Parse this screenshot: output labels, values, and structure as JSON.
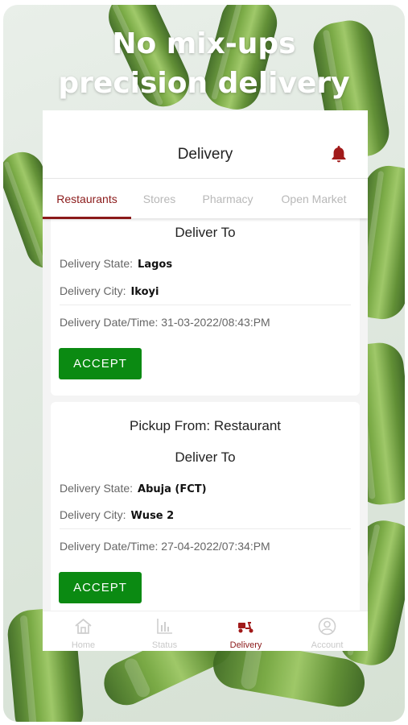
{
  "poster": {
    "headline_line1": "No mix-ups",
    "headline_line2": "precision delivery"
  },
  "appbar": {
    "title": "Delivery",
    "bell_icon": "bell-icon",
    "accent_color": "#8b1a1a"
  },
  "tabs": [
    {
      "label": "Restaurants",
      "active": true
    },
    {
      "label": "Stores",
      "active": false
    },
    {
      "label": "Pharmacy",
      "active": false
    },
    {
      "label": "Open Market",
      "active": false
    }
  ],
  "orders": [
    {
      "deliver_to_label": "Deliver To",
      "state_label": "Delivery State:",
      "state_value": "Lagos",
      "city_label": "Delivery City:",
      "city_value": "Ikoyi",
      "datetime_text": "Delivery Date/Time: 31-03-2022/08:43:PM",
      "accept_label": "ACCEPT"
    },
    {
      "pickup_text": "Pickup From: Restaurant",
      "deliver_to_label": "Deliver To",
      "state_label": "Delivery State:",
      "state_value": "Abuja (FCT)",
      "city_label": "Delivery City:",
      "city_value": "Wuse 2",
      "datetime_text": "Delivery Date/Time: 27-04-2022/07:34:PM",
      "accept_label": "ACCEPT"
    }
  ],
  "bottom_nav": [
    {
      "label": "Home",
      "icon": "home-icon",
      "active": false
    },
    {
      "label": "Status",
      "icon": "bar-chart-icon",
      "active": false
    },
    {
      "label": "Delivery",
      "icon": "scooter-icon",
      "active": true
    },
    {
      "label": "Account",
      "icon": "account-icon",
      "active": false
    }
  ],
  "colors": {
    "accept_button": "#0b8a12",
    "active_tab": "#8b1a1a"
  }
}
